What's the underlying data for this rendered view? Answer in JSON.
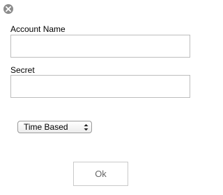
{
  "dialog": {
    "close_icon": "close-icon"
  },
  "form": {
    "account_name": {
      "label": "Account Name",
      "value": "",
      "placeholder": ""
    },
    "secret": {
      "label": "Secret",
      "value": "",
      "placeholder": ""
    },
    "type_select": {
      "selected": "Time Based",
      "icon": "chevron-up-down-icon"
    },
    "ok_label": "Ok"
  }
}
